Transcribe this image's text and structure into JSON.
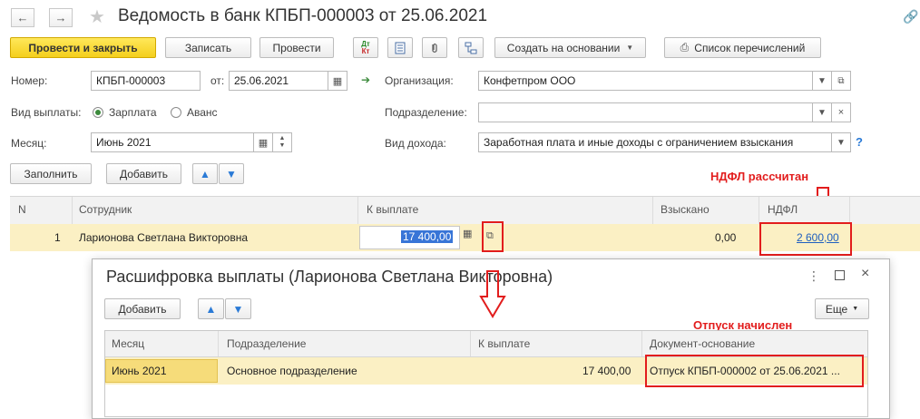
{
  "window": {
    "title": "Ведомость в банк КПБП-000003 от 25.06.2021"
  },
  "toolbar": {
    "post_close": "Провести и закрыть",
    "save": "Записать",
    "post": "Провести",
    "dtkt_top": "Дт",
    "dtkt_bottom": "Кт",
    "create_based": "Создать на основании",
    "transfers_list": "Список перечислений"
  },
  "form": {
    "number_label": "Номер:",
    "number_value": "КПБП-000003",
    "date_label": "от:",
    "date_value": "25.06.2021",
    "org_label": "Организация:",
    "org_value": "Конфетпром ООО",
    "payment_type_label": "Вид выплаты:",
    "payment_salary": "Зарплата",
    "payment_advance": "Аванс",
    "subdivision_label": "Подразделение:",
    "subdivision_value": "",
    "month_label": "Месяц:",
    "month_value": "Июнь 2021",
    "income_type_label": "Вид дохода:",
    "income_type_value": "Заработная плата и иные доходы с ограничением взыскания",
    "help": "?",
    "fill": "Заполнить",
    "add": "Добавить"
  },
  "table": {
    "headers": {
      "n": "N",
      "employee": "Сотрудник",
      "to_pay": "К выплате",
      "collected": "Взыскано",
      "ndfl": "НДФЛ"
    },
    "row": {
      "n": "1",
      "employee": "Ларионова Светлана Викторовна",
      "to_pay": "17 400,00",
      "collected": "0,00",
      "ndfl": "2 600,00"
    }
  },
  "annotations": {
    "ndfl": "НДФЛ рассчитан",
    "vacation": "Отпуск начислен"
  },
  "dialog": {
    "title": "Расшифровка выплаты (Ларионова Светлана Викторовна)",
    "add": "Добавить",
    "more": "Еще",
    "headers": {
      "month": "Месяц",
      "subdivision": "Подразделение",
      "to_pay": "К выплате",
      "basis": "Документ-основание"
    },
    "row": {
      "month": "Июнь 2021",
      "subdivision": "Основное подразделение",
      "to_pay": "17 400,00",
      "basis": "Отпуск КПБП-000002 от 25.06.2021 ..."
    }
  },
  "colors": {
    "accent_yellow": "#f4cf1d",
    "row_highlight": "#fbf0c4",
    "annotation_red": "#e21d1d",
    "link_blue": "#1f5fbf"
  }
}
